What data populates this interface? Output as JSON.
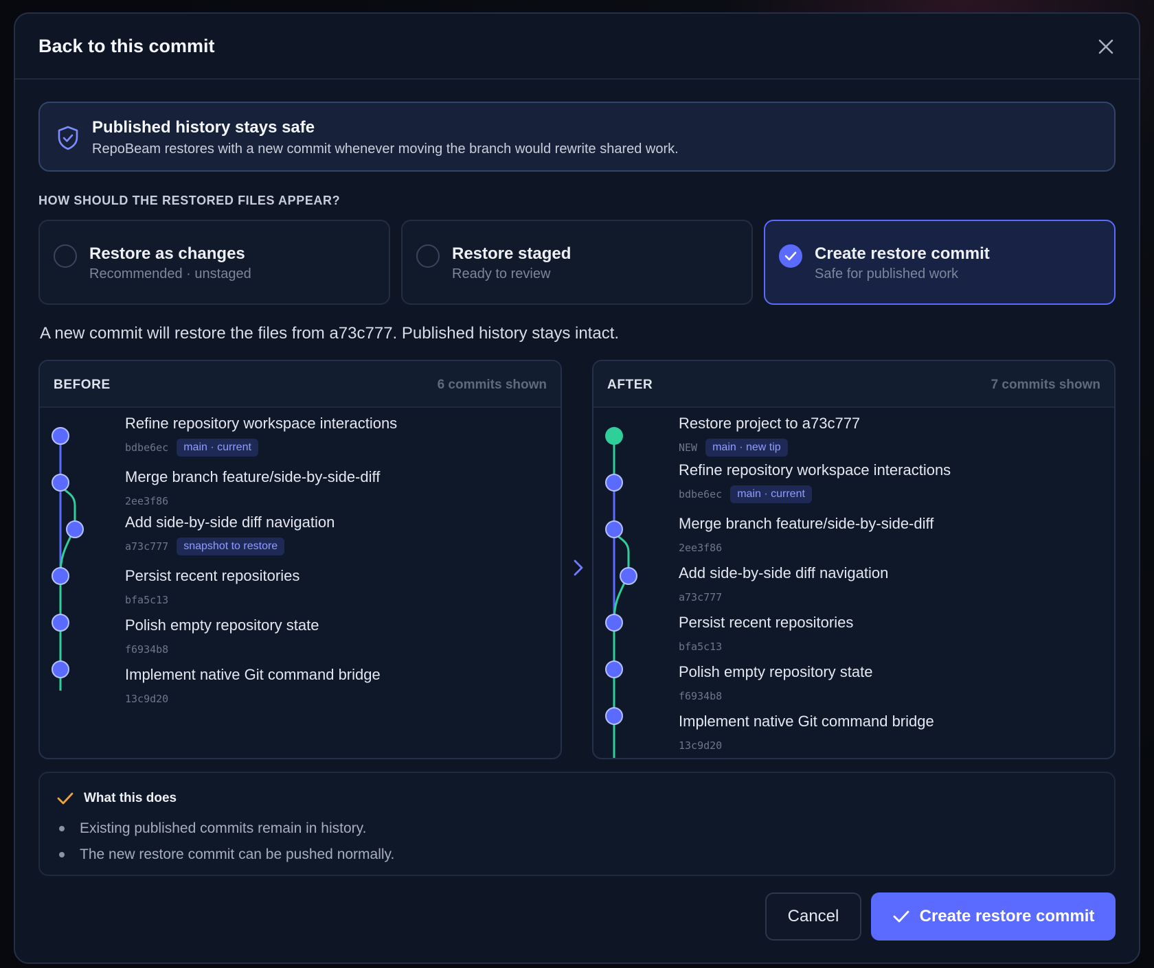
{
  "dialog": {
    "title": "Back to this commit"
  },
  "banner": {
    "title": "Published history stays safe",
    "text": "RepoBeam restores with a new commit whenever moving the branch would rewrite shared work."
  },
  "section_label": "HOW SHOULD THE RESTORED FILES APPEAR?",
  "options": [
    {
      "title": "Restore as changes",
      "subtitle": "Recommended · unstaged",
      "selected": false
    },
    {
      "title": "Restore staged",
      "subtitle": "Ready to review",
      "selected": false
    },
    {
      "title": "Create restore commit",
      "subtitle": "Safe for published work",
      "selected": true
    }
  ],
  "summary": "A new commit will restore the files from a73c777. Published history stays intact.",
  "before": {
    "title": "BEFORE",
    "count": "6 commits shown",
    "commits": [
      {
        "title": "Refine repository workspace interactions",
        "hash": "bdbe6ec",
        "badge": "main · current"
      },
      {
        "title": "Merge branch feature/side-by-side-diff",
        "hash": "2ee3f86"
      },
      {
        "title": "Add side-by-side diff navigation",
        "hash": "a73c777",
        "badge": "snapshot to restore"
      },
      {
        "title": "Persist recent repositories",
        "hash": "bfa5c13"
      },
      {
        "title": "Polish empty repository state",
        "hash": "f6934b8"
      },
      {
        "title": "Implement native Git command bridge",
        "hash": "13c9d20"
      }
    ]
  },
  "after": {
    "title": "AFTER",
    "count": "7 commits shown",
    "commits": [
      {
        "title": "Restore project to a73c777",
        "hash": "NEW",
        "badge": "main · new tip"
      },
      {
        "title": "Refine repository workspace interactions",
        "hash": "bdbe6ec",
        "badge": "main · current"
      },
      {
        "title": "Merge branch feature/side-by-side-diff",
        "hash": "2ee3f86"
      },
      {
        "title": "Add side-by-side diff navigation",
        "hash": "a73c777"
      },
      {
        "title": "Persist recent repositories",
        "hash": "bfa5c13"
      },
      {
        "title": "Polish empty repository state",
        "hash": "f6934b8"
      },
      {
        "title": "Implement native Git command bridge",
        "hash": "13c9d20"
      }
    ]
  },
  "info": {
    "title": "What this does",
    "items": [
      "Existing published commits remain in history.",
      "The new restore commit can be pushed normally."
    ]
  },
  "buttons": {
    "cancel": "Cancel",
    "confirm": "Create restore commit"
  },
  "colors": {
    "accent": "#5b6bff",
    "graph_main": "#5b6bff",
    "graph_branch": "#2fcf9a",
    "new_commit": "#2fcf9a",
    "info_check": "#f0a33a"
  },
  "icons": {
    "close": "close-icon",
    "shield": "shield-check-icon",
    "arrow": "chevron-right-icon",
    "check": "check-icon"
  }
}
